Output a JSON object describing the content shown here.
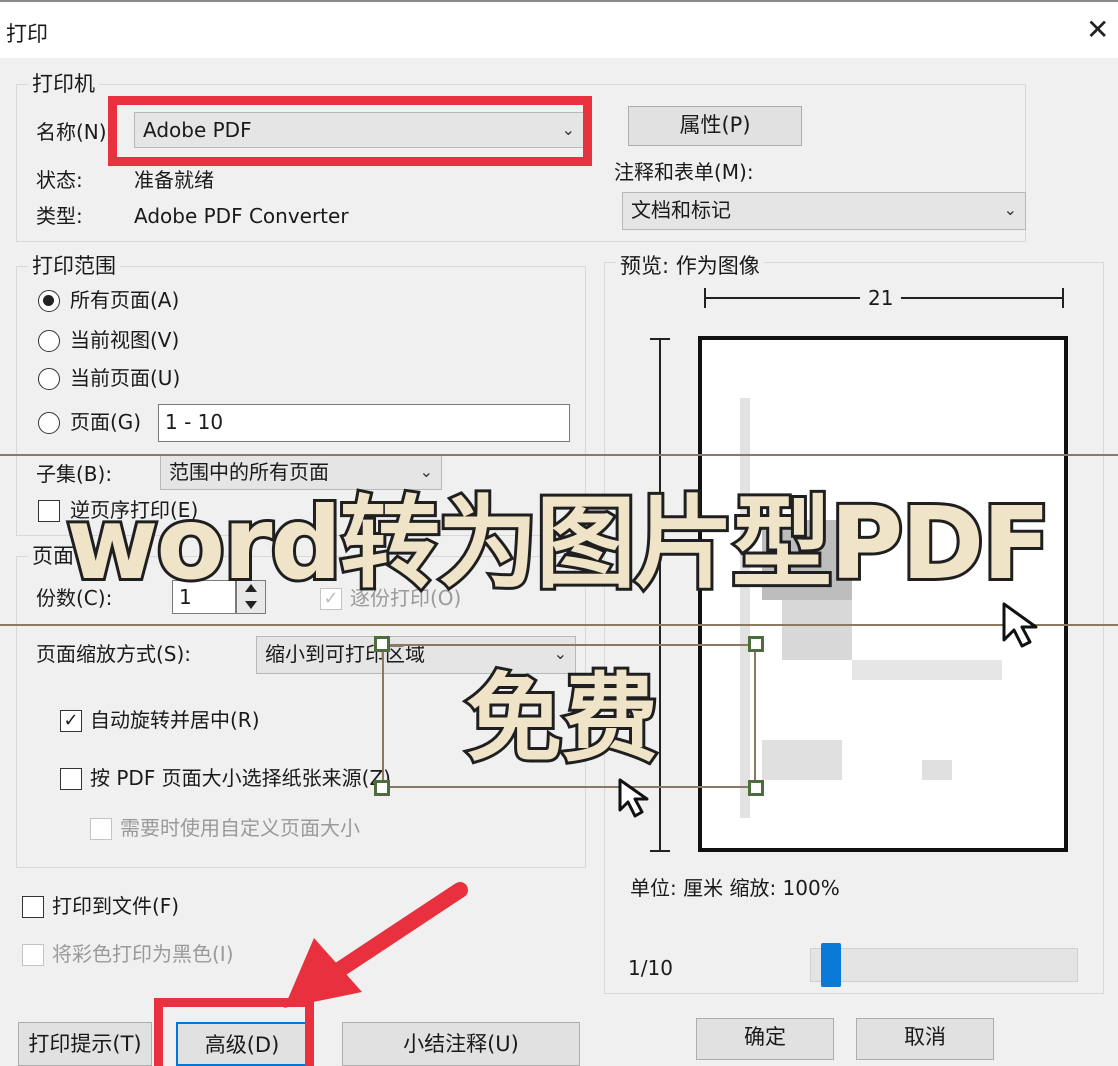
{
  "window": {
    "title": "打印",
    "close_glyph": "✕"
  },
  "printer": {
    "legend": "打印机",
    "name_label": "名称(N):",
    "name_value": "Adobe PDF",
    "status_label": "状态:",
    "status_value": "准备就绪",
    "type_label": "类型:",
    "type_value": "Adobe PDF Converter",
    "properties_button": "属性(P)",
    "comments_label": "注释和表单(M):",
    "comments_value": "文档和标记"
  },
  "range": {
    "legend": "打印范围",
    "all_pages": "所有页面(A)",
    "current_view": "当前视图(V)",
    "current_page": "当前页面(U)",
    "pages": "页面(G)",
    "pages_value": "1 - 10",
    "subset_label": "子集(B):",
    "subset_value": "范围中的所有页面",
    "reverse": "逆页序打印(E)"
  },
  "handling": {
    "legend": "页面",
    "copies_label": "份数(C):",
    "copies_value": "1",
    "collate": "逐份打印(O)",
    "scaling_label": "页面缩放方式(S):",
    "scaling_value": "缩小到可打印区域",
    "auto_rotate": "自动旋转并居中(R)",
    "choose_paper": "按 PDF 页面大小选择纸张来源(Z)",
    "custom_size": "需要时使用自定义页面大小"
  },
  "print_to_file": "打印到文件(F)",
  "print_black": "将彩色打印为黑色(I)",
  "preview": {
    "label": "预览: 作为图像",
    "width_value": "21",
    "units": "单位: 厘米 缩放: 100%",
    "page_counter": "1/10",
    "slider_fraction": 0.04
  },
  "buttons": {
    "tips": "打印提示(T)",
    "advanced": "高级(D)",
    "summarize": "小结注释(U)",
    "ok": "确定",
    "cancel": "取消"
  },
  "overlay": {
    "headline": "word转为图片型PDF",
    "subline": "免费"
  },
  "colors": {
    "highlight_red": "#e8303f",
    "slider_blue": "#0a7ad8",
    "overlay_text": "#efe3c8"
  },
  "icons": {
    "dropdown": "chevron-down-icon",
    "cursor": "mouse-pointer-icon",
    "arrow": "red-arrow-icon",
    "close": "close-icon"
  }
}
